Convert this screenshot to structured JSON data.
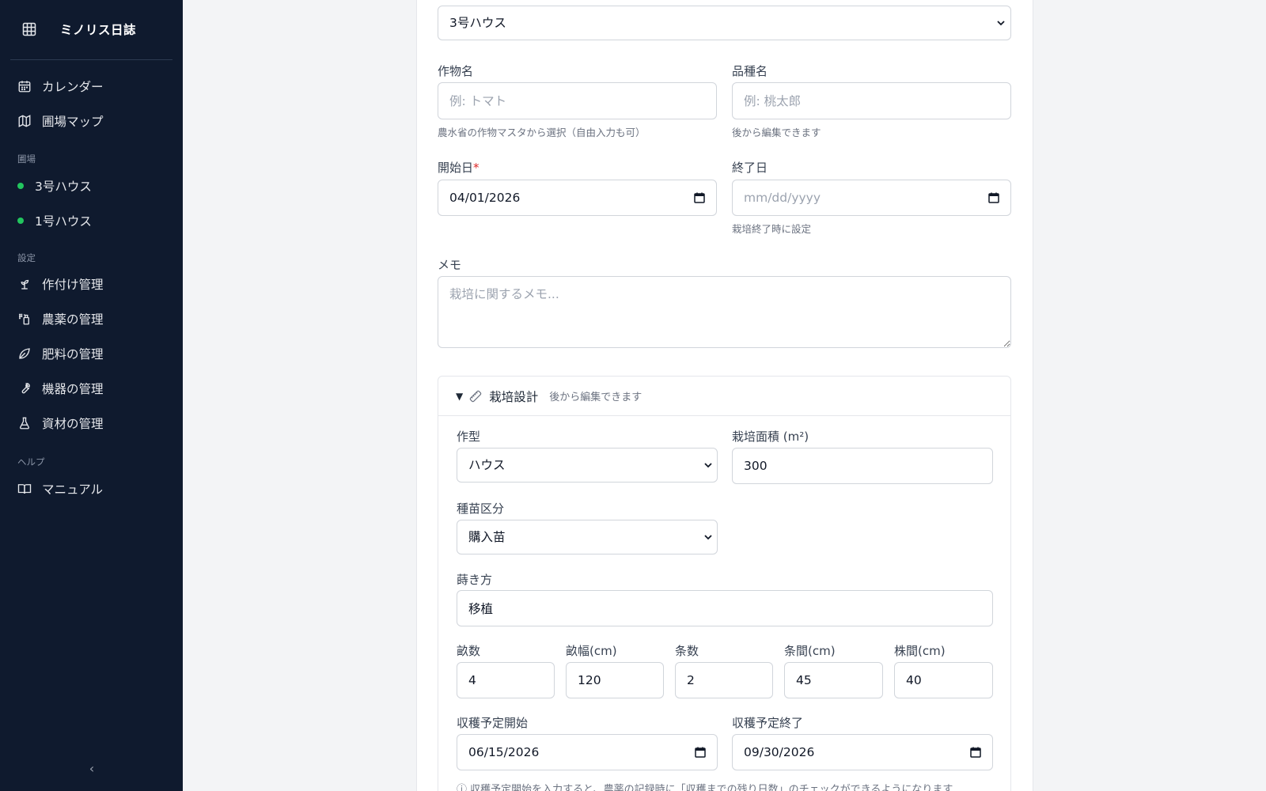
{
  "app": {
    "title": "ミノリス日誌"
  },
  "sidebar": {
    "nav_top": [
      {
        "label": "カレンダー",
        "icon": "calendar-icon"
      },
      {
        "label": "圃場マップ",
        "icon": "map-icon"
      }
    ],
    "fields_section": "圃場",
    "fields": [
      {
        "label": "3号ハウス",
        "status_color": "#22c55e"
      },
      {
        "label": "1号ハウス",
        "status_color": "#22c55e"
      }
    ],
    "settings_section": "設定",
    "settings": [
      {
        "label": "作付け管理",
        "icon": "sprout-icon"
      },
      {
        "label": "農薬の管理",
        "icon": "spray-icon"
      },
      {
        "label": "肥料の管理",
        "icon": "leaf-icon"
      },
      {
        "label": "機器の管理",
        "icon": "wrench-icon"
      },
      {
        "label": "資材の管理",
        "icon": "flask-icon"
      }
    ],
    "help_section": "ヘルプ",
    "help": [
      {
        "label": "マニュアル",
        "icon": "book-icon"
      }
    ],
    "collapse_glyph": "‹"
  },
  "form": {
    "field_select": {
      "value": "3号ハウス"
    },
    "crop": {
      "label": "作物名",
      "placeholder": "例: トマト",
      "hint": "農水省の作物マスタから選択（自由入力も可）"
    },
    "variety": {
      "label": "品種名",
      "placeholder": "例: 桃太郎",
      "hint": "後から編集できます"
    },
    "start_date": {
      "label": "開始日",
      "required_mark": "*",
      "value": "04/01/2026"
    },
    "end_date": {
      "label": "終了日",
      "placeholder": "mm/dd/yyyy",
      "hint": "栽培終了時に設定"
    },
    "memo": {
      "label": "メモ",
      "placeholder": "栽培に関するメモ..."
    },
    "design": {
      "toggle_glyph": "▼",
      "title": "栽培設計",
      "subtitle": "後から編集できます",
      "crop_type": {
        "label": "作型",
        "value": "ハウス"
      },
      "area": {
        "label": "栽培面積 (m²)",
        "value": "300"
      },
      "seedling": {
        "label": "種苗区分",
        "value": "購入苗"
      },
      "sowing": {
        "label": "蒔き方",
        "value": "移植"
      },
      "beds": {
        "label": "畝数",
        "value": "4"
      },
      "bed_width": {
        "label": "畝幅(cm)",
        "value": "120"
      },
      "rows": {
        "label": "条数",
        "value": "2"
      },
      "row_spacing": {
        "label": "条間(cm)",
        "value": "45"
      },
      "plant_spacing": {
        "label": "株間(cm)",
        "value": "40"
      },
      "harvest_start": {
        "label": "収穫予定開始",
        "value": "06/15/2026"
      },
      "harvest_end": {
        "label": "収穫予定終了",
        "value": "09/30/2026"
      },
      "note": "ⓘ 収穫予定開始を入力すると、農薬の記録時に「収穫までの残り日数」のチェックができるようになります"
    }
  }
}
